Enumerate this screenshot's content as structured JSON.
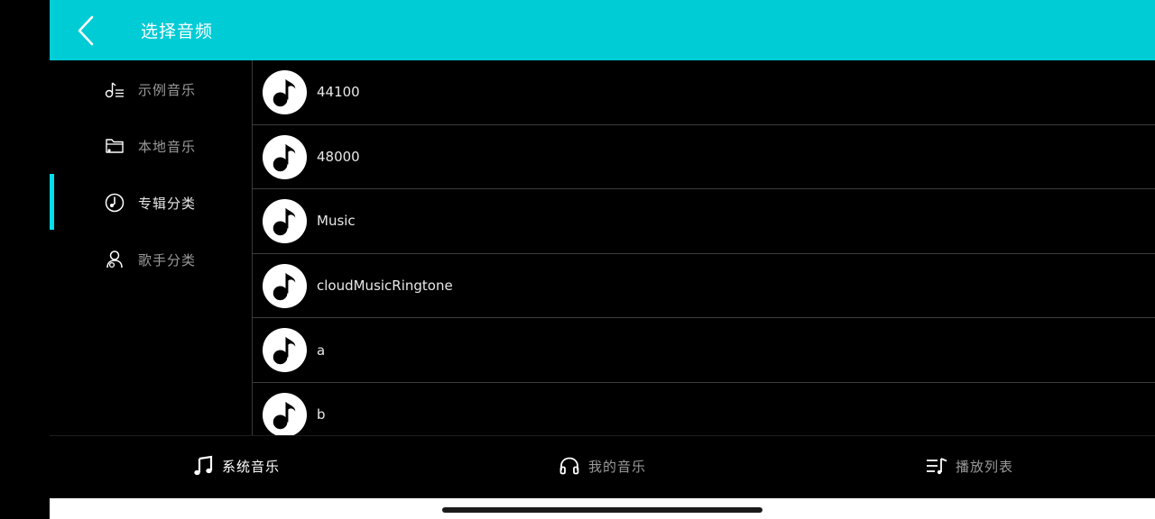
{
  "header": {
    "title": "选择音频"
  },
  "sidebar": {
    "items": [
      {
        "label": "示例音乐",
        "icon": "sample-music-icon"
      },
      {
        "label": "本地音乐",
        "icon": "local-folder-icon"
      },
      {
        "label": "专辑分类",
        "icon": "album-disc-icon",
        "active": true
      },
      {
        "label": "歌手分类",
        "icon": "singer-person-icon"
      }
    ]
  },
  "list": {
    "items": [
      {
        "label": "44100"
      },
      {
        "label": "48000"
      },
      {
        "label": "Music"
      },
      {
        "label": "cloudMusicRingtone"
      },
      {
        "label": "a"
      },
      {
        "label": "b"
      }
    ]
  },
  "bottom_nav": {
    "tabs": [
      {
        "label": "系统音乐",
        "icon": "music-note-icon",
        "active": true
      },
      {
        "label": "我的音乐",
        "icon": "headphones-icon"
      },
      {
        "label": "播放列表",
        "icon": "playlist-icon"
      }
    ]
  },
  "colors": {
    "accent": "#00ccd6",
    "indicator": "#00e0ea",
    "background": "#000000"
  }
}
